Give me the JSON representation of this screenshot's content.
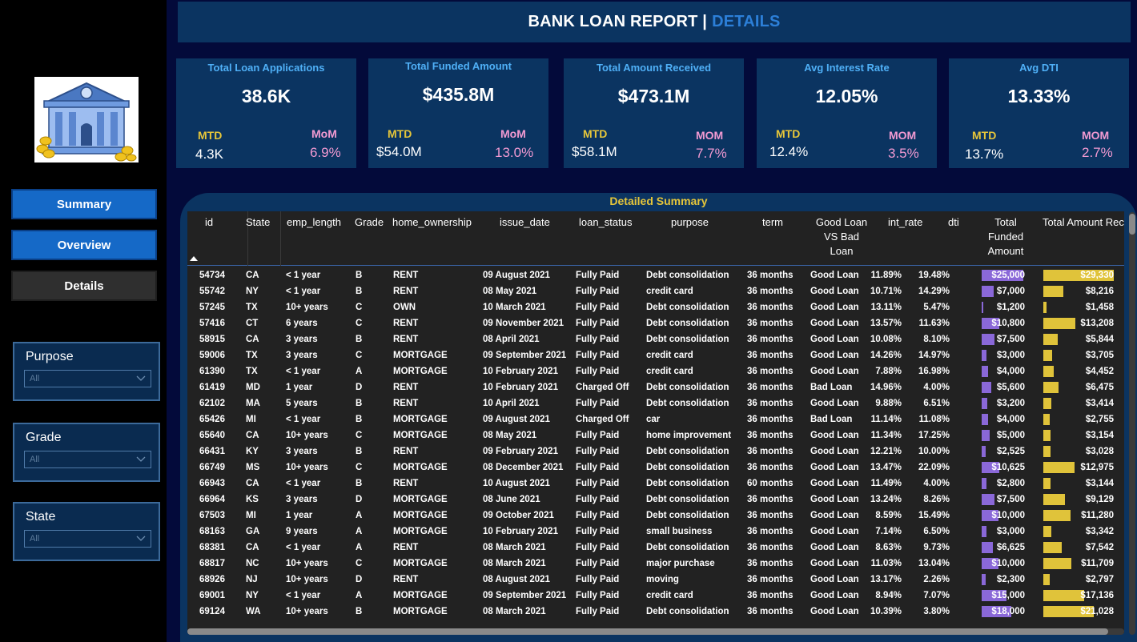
{
  "nav": {
    "summary": "Summary",
    "overview": "Overview",
    "details": "Details"
  },
  "slicers": {
    "purpose": {
      "title": "Purpose",
      "value": "All"
    },
    "grade": {
      "title": "Grade",
      "value": "All"
    },
    "state": {
      "title": "State",
      "value": "All"
    }
  },
  "header": {
    "title": "BANK LOAN REPORT |",
    "accent": "DETAILS"
  },
  "kpis": [
    {
      "title": "Total Loan Applications",
      "value": "38.6K",
      "mtd_label": "MTD",
      "mom_label": "MoM",
      "mtd": "4.3K",
      "mom": "6.9%"
    },
    {
      "title": "Total Funded Amount",
      "value": "$435.8M",
      "mtd_label": "MTD",
      "mom_label": "MoM",
      "mtd": "$54.0M",
      "mom": "13.0%"
    },
    {
      "title": "Total Amount Received",
      "value": "$473.1M",
      "mtd_label": "MTD",
      "mom_label": "MOM",
      "mtd": "$58.1M",
      "mom": "7.7%"
    },
    {
      "title": "Avg Interest Rate",
      "value": "12.05%",
      "mtd_label": "MTD",
      "mom_label": "MOM",
      "mtd": "12.4%",
      "mom": "3.5%"
    },
    {
      "title": "Avg DTI",
      "value": "13.33%",
      "mtd_label": "MTD",
      "mom_label": "MOM",
      "mtd": "13.7%",
      "mom": "2.7%"
    }
  ],
  "table": {
    "title": "Detailed Summary",
    "headers": {
      "id": "id",
      "state": "State",
      "emp_length": "emp_length",
      "grade": "Grade",
      "home_ownership": "home_ownership",
      "issue_date": "issue_date",
      "loan_status": "loan_status",
      "purpose": "purpose",
      "term": "term",
      "good_bad_1": "Good Loan",
      "good_bad_2": "VS Bad Loan",
      "int_rate": "int_rate",
      "dti": "dti",
      "funded_1": "Total",
      "funded_2": "Funded",
      "funded_3": "Amount",
      "received": "Total Amount Rec"
    },
    "funded_max": 25000,
    "received_max": 29330,
    "colors": {
      "funded_bar": "#8a68d8",
      "received_bar": "#e0c33a"
    },
    "rows": [
      {
        "id": "54734",
        "state": "CA",
        "emp": "< 1 year",
        "grade": "B",
        "home": "RENT",
        "date": "09 August 2021",
        "status": "Fully Paid",
        "purpose": "Debt consolidation",
        "term": "36 months",
        "gb": "Good Loan",
        "rate": "11.89%",
        "dti": "19.48%",
        "funded": "$25,000",
        "funded_v": 25000,
        "received": "$29,330",
        "received_v": 29330
      },
      {
        "id": "55742",
        "state": "NY",
        "emp": "< 1 year",
        "grade": "B",
        "home": "RENT",
        "date": "08 May 2021",
        "status": "Fully Paid",
        "purpose": "credit card",
        "term": "36 months",
        "gb": "Good Loan",
        "rate": "10.71%",
        "dti": "14.29%",
        "funded": "$7,000",
        "funded_v": 7000,
        "received": "$8,216",
        "received_v": 8216
      },
      {
        "id": "57245",
        "state": "TX",
        "emp": "10+ years",
        "grade": "C",
        "home": "OWN",
        "date": "10 March 2021",
        "status": "Fully Paid",
        "purpose": "Debt consolidation",
        "term": "36 months",
        "gb": "Good Loan",
        "rate": "13.11%",
        "dti": "5.47%",
        "funded": "$1,200",
        "funded_v": 1200,
        "received": "$1,458",
        "received_v": 1458
      },
      {
        "id": "57416",
        "state": "CT",
        "emp": "6 years",
        "grade": "C",
        "home": "RENT",
        "date": "09 November 2021",
        "status": "Fully Paid",
        "purpose": "Debt consolidation",
        "term": "36 months",
        "gb": "Good Loan",
        "rate": "13.57%",
        "dti": "11.63%",
        "funded": "$10,800",
        "funded_v": 10800,
        "received": "$13,208",
        "received_v": 13208
      },
      {
        "id": "58915",
        "state": "CA",
        "emp": "3 years",
        "grade": "B",
        "home": "RENT",
        "date": "08 April 2021",
        "status": "Fully Paid",
        "purpose": "Debt consolidation",
        "term": "36 months",
        "gb": "Good Loan",
        "rate": "10.08%",
        "dti": "8.10%",
        "funded": "$7,500",
        "funded_v": 7500,
        "received": "$5,844",
        "received_v": 5844
      },
      {
        "id": "59006",
        "state": "TX",
        "emp": "3 years",
        "grade": "C",
        "home": "MORTGAGE",
        "date": "09 September 2021",
        "status": "Fully Paid",
        "purpose": "credit card",
        "term": "36 months",
        "gb": "Good Loan",
        "rate": "14.26%",
        "dti": "14.97%",
        "funded": "$3,000",
        "funded_v": 3000,
        "received": "$3,705",
        "received_v": 3705
      },
      {
        "id": "61390",
        "state": "TX",
        "emp": "< 1 year",
        "grade": "A",
        "home": "MORTGAGE",
        "date": "10 February 2021",
        "status": "Fully Paid",
        "purpose": "credit card",
        "term": "36 months",
        "gb": "Good Loan",
        "rate": "7.88%",
        "dti": "16.98%",
        "funded": "$4,000",
        "funded_v": 4000,
        "received": "$4,452",
        "received_v": 4452
      },
      {
        "id": "61419",
        "state": "MD",
        "emp": "1 year",
        "grade": "D",
        "home": "RENT",
        "date": "10 February 2021",
        "status": "Charged Off",
        "purpose": "Debt consolidation",
        "term": "36 months",
        "gb": "Bad Loan",
        "rate": "14.96%",
        "dti": "4.00%",
        "funded": "$5,600",
        "funded_v": 5600,
        "received": "$6,475",
        "received_v": 6475
      },
      {
        "id": "62102",
        "state": "MA",
        "emp": "5 years",
        "grade": "B",
        "home": "RENT",
        "date": "10 April 2021",
        "status": "Fully Paid",
        "purpose": "Debt consolidation",
        "term": "36 months",
        "gb": "Good Loan",
        "rate": "9.88%",
        "dti": "6.51%",
        "funded": "$3,200",
        "funded_v": 3200,
        "received": "$3,414",
        "received_v": 3414
      },
      {
        "id": "65426",
        "state": "MI",
        "emp": "< 1 year",
        "grade": "B",
        "home": "MORTGAGE",
        "date": "09 August 2021",
        "status": "Charged Off",
        "purpose": "car",
        "term": "36 months",
        "gb": "Bad Loan",
        "rate": "11.14%",
        "dti": "11.08%",
        "funded": "$4,000",
        "funded_v": 4000,
        "received": "$2,755",
        "received_v": 2755
      },
      {
        "id": "65640",
        "state": "CA",
        "emp": "10+ years",
        "grade": "C",
        "home": "MORTGAGE",
        "date": "08 May 2021",
        "status": "Fully Paid",
        "purpose": "home improvement",
        "term": "36 months",
        "gb": "Good Loan",
        "rate": "11.34%",
        "dti": "17.25%",
        "funded": "$5,000",
        "funded_v": 5000,
        "received": "$3,154",
        "received_v": 3154
      },
      {
        "id": "66431",
        "state": "KY",
        "emp": "3 years",
        "grade": "B",
        "home": "RENT",
        "date": "09 February 2021",
        "status": "Fully Paid",
        "purpose": "Debt consolidation",
        "term": "36 months",
        "gb": "Good Loan",
        "rate": "12.21%",
        "dti": "10.00%",
        "funded": "$2,525",
        "funded_v": 2525,
        "received": "$3,028",
        "received_v": 3028
      },
      {
        "id": "66749",
        "state": "MS",
        "emp": "10+ years",
        "grade": "C",
        "home": "MORTGAGE",
        "date": "08 December 2021",
        "status": "Fully Paid",
        "purpose": "Debt consolidation",
        "term": "36 months",
        "gb": "Good Loan",
        "rate": "13.47%",
        "dti": "22.09%",
        "funded": "$10,625",
        "funded_v": 10625,
        "received": "$12,975",
        "received_v": 12975
      },
      {
        "id": "66943",
        "state": "CA",
        "emp": "< 1 year",
        "grade": "B",
        "home": "RENT",
        "date": "10 August 2021",
        "status": "Fully Paid",
        "purpose": "Debt consolidation",
        "term": "60 months",
        "gb": "Good Loan",
        "rate": "11.49%",
        "dti": "4.00%",
        "funded": "$2,800",
        "funded_v": 2800,
        "received": "$3,144",
        "received_v": 3144
      },
      {
        "id": "66964",
        "state": "KS",
        "emp": "3 years",
        "grade": "D",
        "home": "MORTGAGE",
        "date": "08 June 2021",
        "status": "Fully Paid",
        "purpose": "Debt consolidation",
        "term": "36 months",
        "gb": "Good Loan",
        "rate": "13.24%",
        "dti": "8.26%",
        "funded": "$7,500",
        "funded_v": 7500,
        "received": "$9,129",
        "received_v": 9129
      },
      {
        "id": "67503",
        "state": "MI",
        "emp": "1 year",
        "grade": "A",
        "home": "MORTGAGE",
        "date": "09 October 2021",
        "status": "Fully Paid",
        "purpose": "Debt consolidation",
        "term": "36 months",
        "gb": "Good Loan",
        "rate": "8.59%",
        "dti": "15.49%",
        "funded": "$10,000",
        "funded_v": 10000,
        "received": "$11,280",
        "received_v": 11280
      },
      {
        "id": "68163",
        "state": "GA",
        "emp": "9 years",
        "grade": "A",
        "home": "MORTGAGE",
        "date": "10 February 2021",
        "status": "Fully Paid",
        "purpose": "small business",
        "term": "36 months",
        "gb": "Good Loan",
        "rate": "7.14%",
        "dti": "6.50%",
        "funded": "$3,000",
        "funded_v": 3000,
        "received": "$3,342",
        "received_v": 3342
      },
      {
        "id": "68381",
        "state": "CA",
        "emp": "< 1 year",
        "grade": "A",
        "home": "RENT",
        "date": "08 March 2021",
        "status": "Fully Paid",
        "purpose": "Debt consolidation",
        "term": "36 months",
        "gb": "Good Loan",
        "rate": "8.63%",
        "dti": "9.73%",
        "funded": "$6,625",
        "funded_v": 6625,
        "received": "$7,542",
        "received_v": 7542
      },
      {
        "id": "68817",
        "state": "NC",
        "emp": "10+ years",
        "grade": "C",
        "home": "MORTGAGE",
        "date": "08 March 2021",
        "status": "Fully Paid",
        "purpose": "major purchase",
        "term": "36 months",
        "gb": "Good Loan",
        "rate": "11.03%",
        "dti": "13.04%",
        "funded": "$10,000",
        "funded_v": 10000,
        "received": "$11,709",
        "received_v": 11709
      },
      {
        "id": "68926",
        "state": "NJ",
        "emp": "10+ years",
        "grade": "D",
        "home": "RENT",
        "date": "08 August 2021",
        "status": "Fully Paid",
        "purpose": "moving",
        "term": "36 months",
        "gb": "Good Loan",
        "rate": "13.17%",
        "dti": "2.26%",
        "funded": "$2,300",
        "funded_v": 2300,
        "received": "$2,797",
        "received_v": 2797
      },
      {
        "id": "69001",
        "state": "NY",
        "emp": "< 1 year",
        "grade": "A",
        "home": "MORTGAGE",
        "date": "09 September 2021",
        "status": "Fully Paid",
        "purpose": "credit card",
        "term": "36 months",
        "gb": "Good Loan",
        "rate": "8.94%",
        "dti": "7.07%",
        "funded": "$15,000",
        "funded_v": 15000,
        "received": "$17,136",
        "received_v": 17136
      },
      {
        "id": "69124",
        "state": "WA",
        "emp": "10+ years",
        "grade": "B",
        "home": "MORTGAGE",
        "date": "08 March 2021",
        "status": "Fully Paid",
        "purpose": "Debt consolidation",
        "term": "36 months",
        "gb": "Good Loan",
        "rate": "10.39%",
        "dti": "3.80%",
        "funded": "$18,000",
        "funded_v": 18000,
        "received": "$21,028",
        "received_v": 21028
      }
    ]
  }
}
